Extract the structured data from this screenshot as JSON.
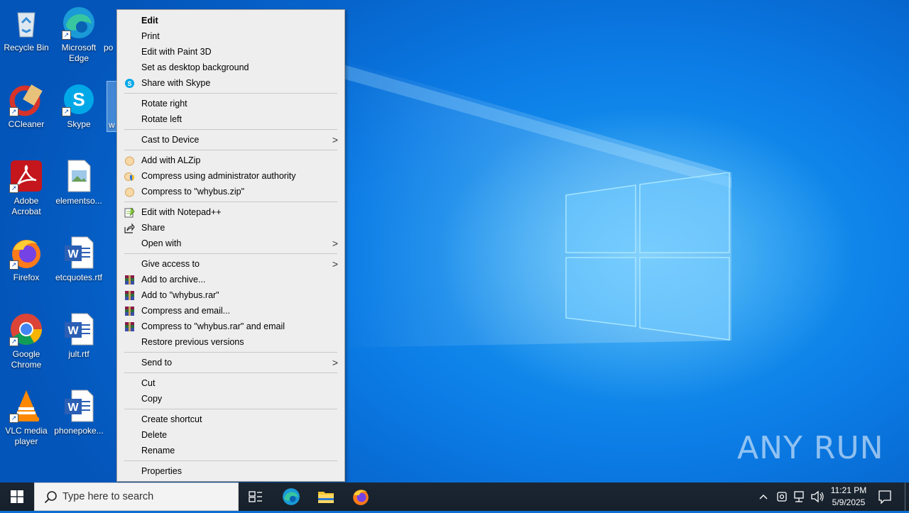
{
  "desktop": {
    "icons": [
      {
        "label": "Recycle Bin"
      },
      {
        "label": "Microsoft Edge"
      },
      {
        "label": "po"
      },
      {
        "label": "CCleaner"
      },
      {
        "label": "Skype"
      },
      {
        "label": "w"
      },
      {
        "label": "Adobe Acrobat"
      },
      {
        "label": "elementso..."
      },
      {
        "label": "Firefox"
      },
      {
        "label": "etcquotes.rtf"
      },
      {
        "label": "Google Chrome"
      },
      {
        "label": "jult.rtf"
      },
      {
        "label": "VLC media player"
      },
      {
        "label": "phonepoke..."
      }
    ],
    "watermark": "ANY RUN"
  },
  "context_menu": {
    "items": [
      {
        "label": "Edit",
        "icon": "",
        "bold": true
      },
      {
        "label": "Print",
        "icon": ""
      },
      {
        "label": "Edit with Paint 3D",
        "icon": ""
      },
      {
        "label": "Set as desktop background",
        "icon": ""
      },
      {
        "label": "Share with Skype",
        "icon": "skype-icon"
      },
      {
        "label": "Rotate right",
        "icon": ""
      },
      {
        "label": "Rotate left",
        "icon": ""
      },
      {
        "label": "Cast to Device",
        "icon": "",
        "submenu": true
      },
      {
        "label": "Add with ALZip",
        "icon": "alzip-icon"
      },
      {
        "label": "Compress using administrator authority",
        "icon": "shield-icon"
      },
      {
        "label": "Compress to \"whybus.zip\"",
        "icon": "alzip-icon"
      },
      {
        "label": "Edit with Notepad++",
        "icon": "notepadpp-icon"
      },
      {
        "label": "Share",
        "icon": "share-icon"
      },
      {
        "label": "Open with",
        "icon": "",
        "submenu": true
      },
      {
        "label": "Give access to",
        "icon": "",
        "submenu": true
      },
      {
        "label": "Add to archive...",
        "icon": "winrar-icon"
      },
      {
        "label": "Add to \"whybus.rar\"",
        "icon": "winrar-icon"
      },
      {
        "label": "Compress and email...",
        "icon": "winrar-icon"
      },
      {
        "label": "Compress to \"whybus.rar\" and email",
        "icon": "winrar-icon"
      },
      {
        "label": "Restore previous versions",
        "icon": ""
      },
      {
        "label": "Send to",
        "icon": "",
        "submenu": true
      },
      {
        "label": "Cut",
        "icon": ""
      },
      {
        "label": "Copy",
        "icon": ""
      },
      {
        "label": "Create shortcut",
        "icon": ""
      },
      {
        "label": "Delete",
        "icon": ""
      },
      {
        "label": "Rename",
        "icon": ""
      },
      {
        "label": "Properties",
        "icon": ""
      }
    ],
    "submenu_arrow": ">"
  },
  "taskbar": {
    "search_placeholder": "Type here to search",
    "time": "11:21 PM",
    "date": "5/9/2025",
    "pinned": [
      "task-view-icon",
      "edge-icon",
      "file-explorer-icon",
      "firefox-icon"
    ]
  },
  "colors": {
    "desktop_bg": "#0a6fd0",
    "menu_bg": "#eeeeee",
    "taskbar_bg": "#1b2632"
  }
}
